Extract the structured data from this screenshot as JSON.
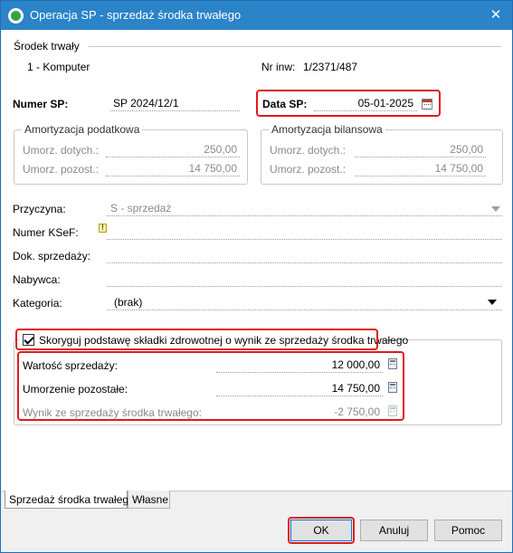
{
  "window": {
    "title": "Operacja SP - sprzedaż środka trwałego",
    "close_label": "✕"
  },
  "asset": {
    "section_label": "Środek trwały",
    "name": "1 - Komputer",
    "inv_label": "Nr inw:",
    "inv_value": "1/2371/487"
  },
  "header": {
    "number_label": "Numer SP:",
    "number_value": "SP 2024/12/1",
    "date_label": "Data SP:",
    "date_value": "05-01-2025"
  },
  "tax_depreciation": {
    "title": "Amortyzacja podatkowa",
    "subsidy_label": "Umorz. dotych.:",
    "subsidy_value": "250,00",
    "remaining_label": "Umorz. pozost.:",
    "remaining_value": "14 750,00"
  },
  "balance_depreciation": {
    "title": "Amortyzacja bilansowa",
    "subsidy_label": "Umorz. dotych.:",
    "subsidy_value": "250,00",
    "remaining_label": "Umorz. pozost.:",
    "remaining_value": "14 750,00"
  },
  "form": {
    "reason_label": "Przyczyna:",
    "reason_value": "S - sprzedaż",
    "ksef_label": "Numer KSeF:",
    "ksef_value": "",
    "sale_doc_label": "Dok. sprzedaży:",
    "sale_doc_value": "",
    "buyer_label": "Nabywca:",
    "buyer_value": "",
    "category_label": "Kategoria:",
    "category_value": "(brak)"
  },
  "health": {
    "checkbox_label": "Skoryguj podstawę składki zdrowotnej o wynik ze sprzedaży środka trwałego",
    "checked": true,
    "sale_value_label": "Wartość sprzedaży:",
    "sale_value": "12 000,00",
    "remaining_label": "Umorzenie pozostałe:",
    "remaining_value": "14 750,00",
    "result_label": "Wynik ze sprzedaży środka trwałego:",
    "result_value": "-2 750,00"
  },
  "tabs": [
    "Sprzedaż środka trwałego",
    "Własne"
  ],
  "buttons": {
    "ok": "OK",
    "cancel": "Anuluj",
    "help": "Pomoc"
  },
  "colors": {
    "titlebar": "#2b83c8",
    "highlight": "#e01b1b"
  }
}
